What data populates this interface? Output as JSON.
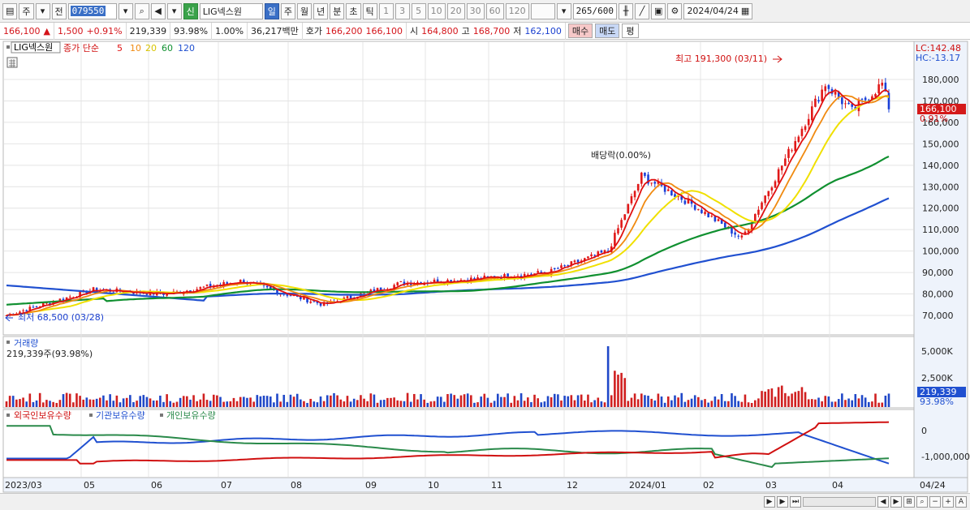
{
  "toolbar": {
    "period_label": "주",
    "prev_label": "전",
    "code": "079550",
    "sin_label": "신",
    "stock_name": "LIG넥스원",
    "tabs": [
      "일",
      "주",
      "월",
      "년",
      "분",
      "초",
      "틱"
    ],
    "intervals": [
      "1",
      "3",
      "5",
      "10",
      "20",
      "30",
      "60",
      "120"
    ],
    "count": "265",
    "count_max": "/600",
    "date": "2024/04/24"
  },
  "quote": {
    "price": "166,100",
    "change": "1,500",
    "change_pct": "+0.91%",
    "volume": "219,339",
    "volume_pct": "93.98%",
    "turnover_pct": "1.00%",
    "amount": "36,217백만",
    "hoga_label": "호가",
    "ask": "166,200",
    "bid": "166,100",
    "open_label": "시",
    "open": "164,800",
    "high_label": "고",
    "high": "168,700",
    "low_label": "저",
    "low": "162,100",
    "buy_label": "매수",
    "sell_label": "매도",
    "pyeong_label": "평"
  },
  "legend": {
    "name": "LIG넥스원",
    "indicator": "종가 단순",
    "ma": [
      {
        "label": "5",
        "color": "#e01010"
      },
      {
        "label": "10",
        "color": "#f08a10"
      },
      {
        "label": "20",
        "color": "#e8d800"
      },
      {
        "label": "60",
        "color": "#109030"
      },
      {
        "label": "120",
        "color": "#2050d0"
      }
    ]
  },
  "lc_text": "LC:142.48",
  "hc_text": "HC:-13.17",
  "price_axis": [
    "180,000",
    "170,000",
    "160,000",
    "150,000",
    "140,000",
    "130,000",
    "120,000",
    "110,000",
    "100,000",
    "90,000",
    "80,000",
    "70,000"
  ],
  "current_price_tag": "166,100",
  "current_pct_tag": "0.91%",
  "annotations": {
    "high": "최고 191,300 (03/11)",
    "low": "최저 68,500 (03/28)",
    "dividend": "배당락(0.00%)"
  },
  "volume_panel": {
    "title": "거래량",
    "value": "219,339주(93.98%)",
    "axis": [
      "5,000K",
      "2,500K"
    ],
    "tag": "219,339",
    "tag_pct": "93.98%"
  },
  "holdings_panel": {
    "legend": [
      {
        "label": "외국인보유수량",
        "color": "#d01010"
      },
      {
        "label": "기관보유수량",
        "color": "#2050d0"
      },
      {
        "label": "개인보유수량",
        "color": "#2a8a4a"
      }
    ],
    "axis": [
      "0",
      "-1,000,000"
    ]
  },
  "x_axis": [
    "2023/03",
    "05",
    "06",
    "07",
    "08",
    "09",
    "10",
    "11",
    "12",
    "2024/01",
    "02",
    "03",
    "04",
    "04/24"
  ],
  "chart_data": {
    "type": "candlestick",
    "ylim": [
      68500,
      191300
    ],
    "close_series": [
      {
        "period": "2023/03",
        "value": 70000
      },
      {
        "period": "2023/05",
        "value": 82000
      },
      {
        "period": "2023/06",
        "value": 80000
      },
      {
        "period": "2023/07",
        "value": 86000
      },
      {
        "period": "2023/08",
        "value": 75000
      },
      {
        "period": "2023/09",
        "value": 85000
      },
      {
        "period": "2023/10",
        "value": 87000
      },
      {
        "period": "2023/11",
        "value": 90000
      },
      {
        "period": "2023/12",
        "value": 100000
      },
      {
        "period": "2023/12b",
        "value": 135000
      },
      {
        "period": "2024/01",
        "value": 122000
      },
      {
        "period": "2024/02",
        "value": 106000
      },
      {
        "period": "2024/02b",
        "value": 140000
      },
      {
        "period": "2024/03",
        "value": 178000
      },
      {
        "period": "2024/03b",
        "value": 165000
      },
      {
        "period": "2024/04",
        "value": 178000
      },
      {
        "period": "2024/04/24",
        "value": 166100
      }
    ]
  }
}
